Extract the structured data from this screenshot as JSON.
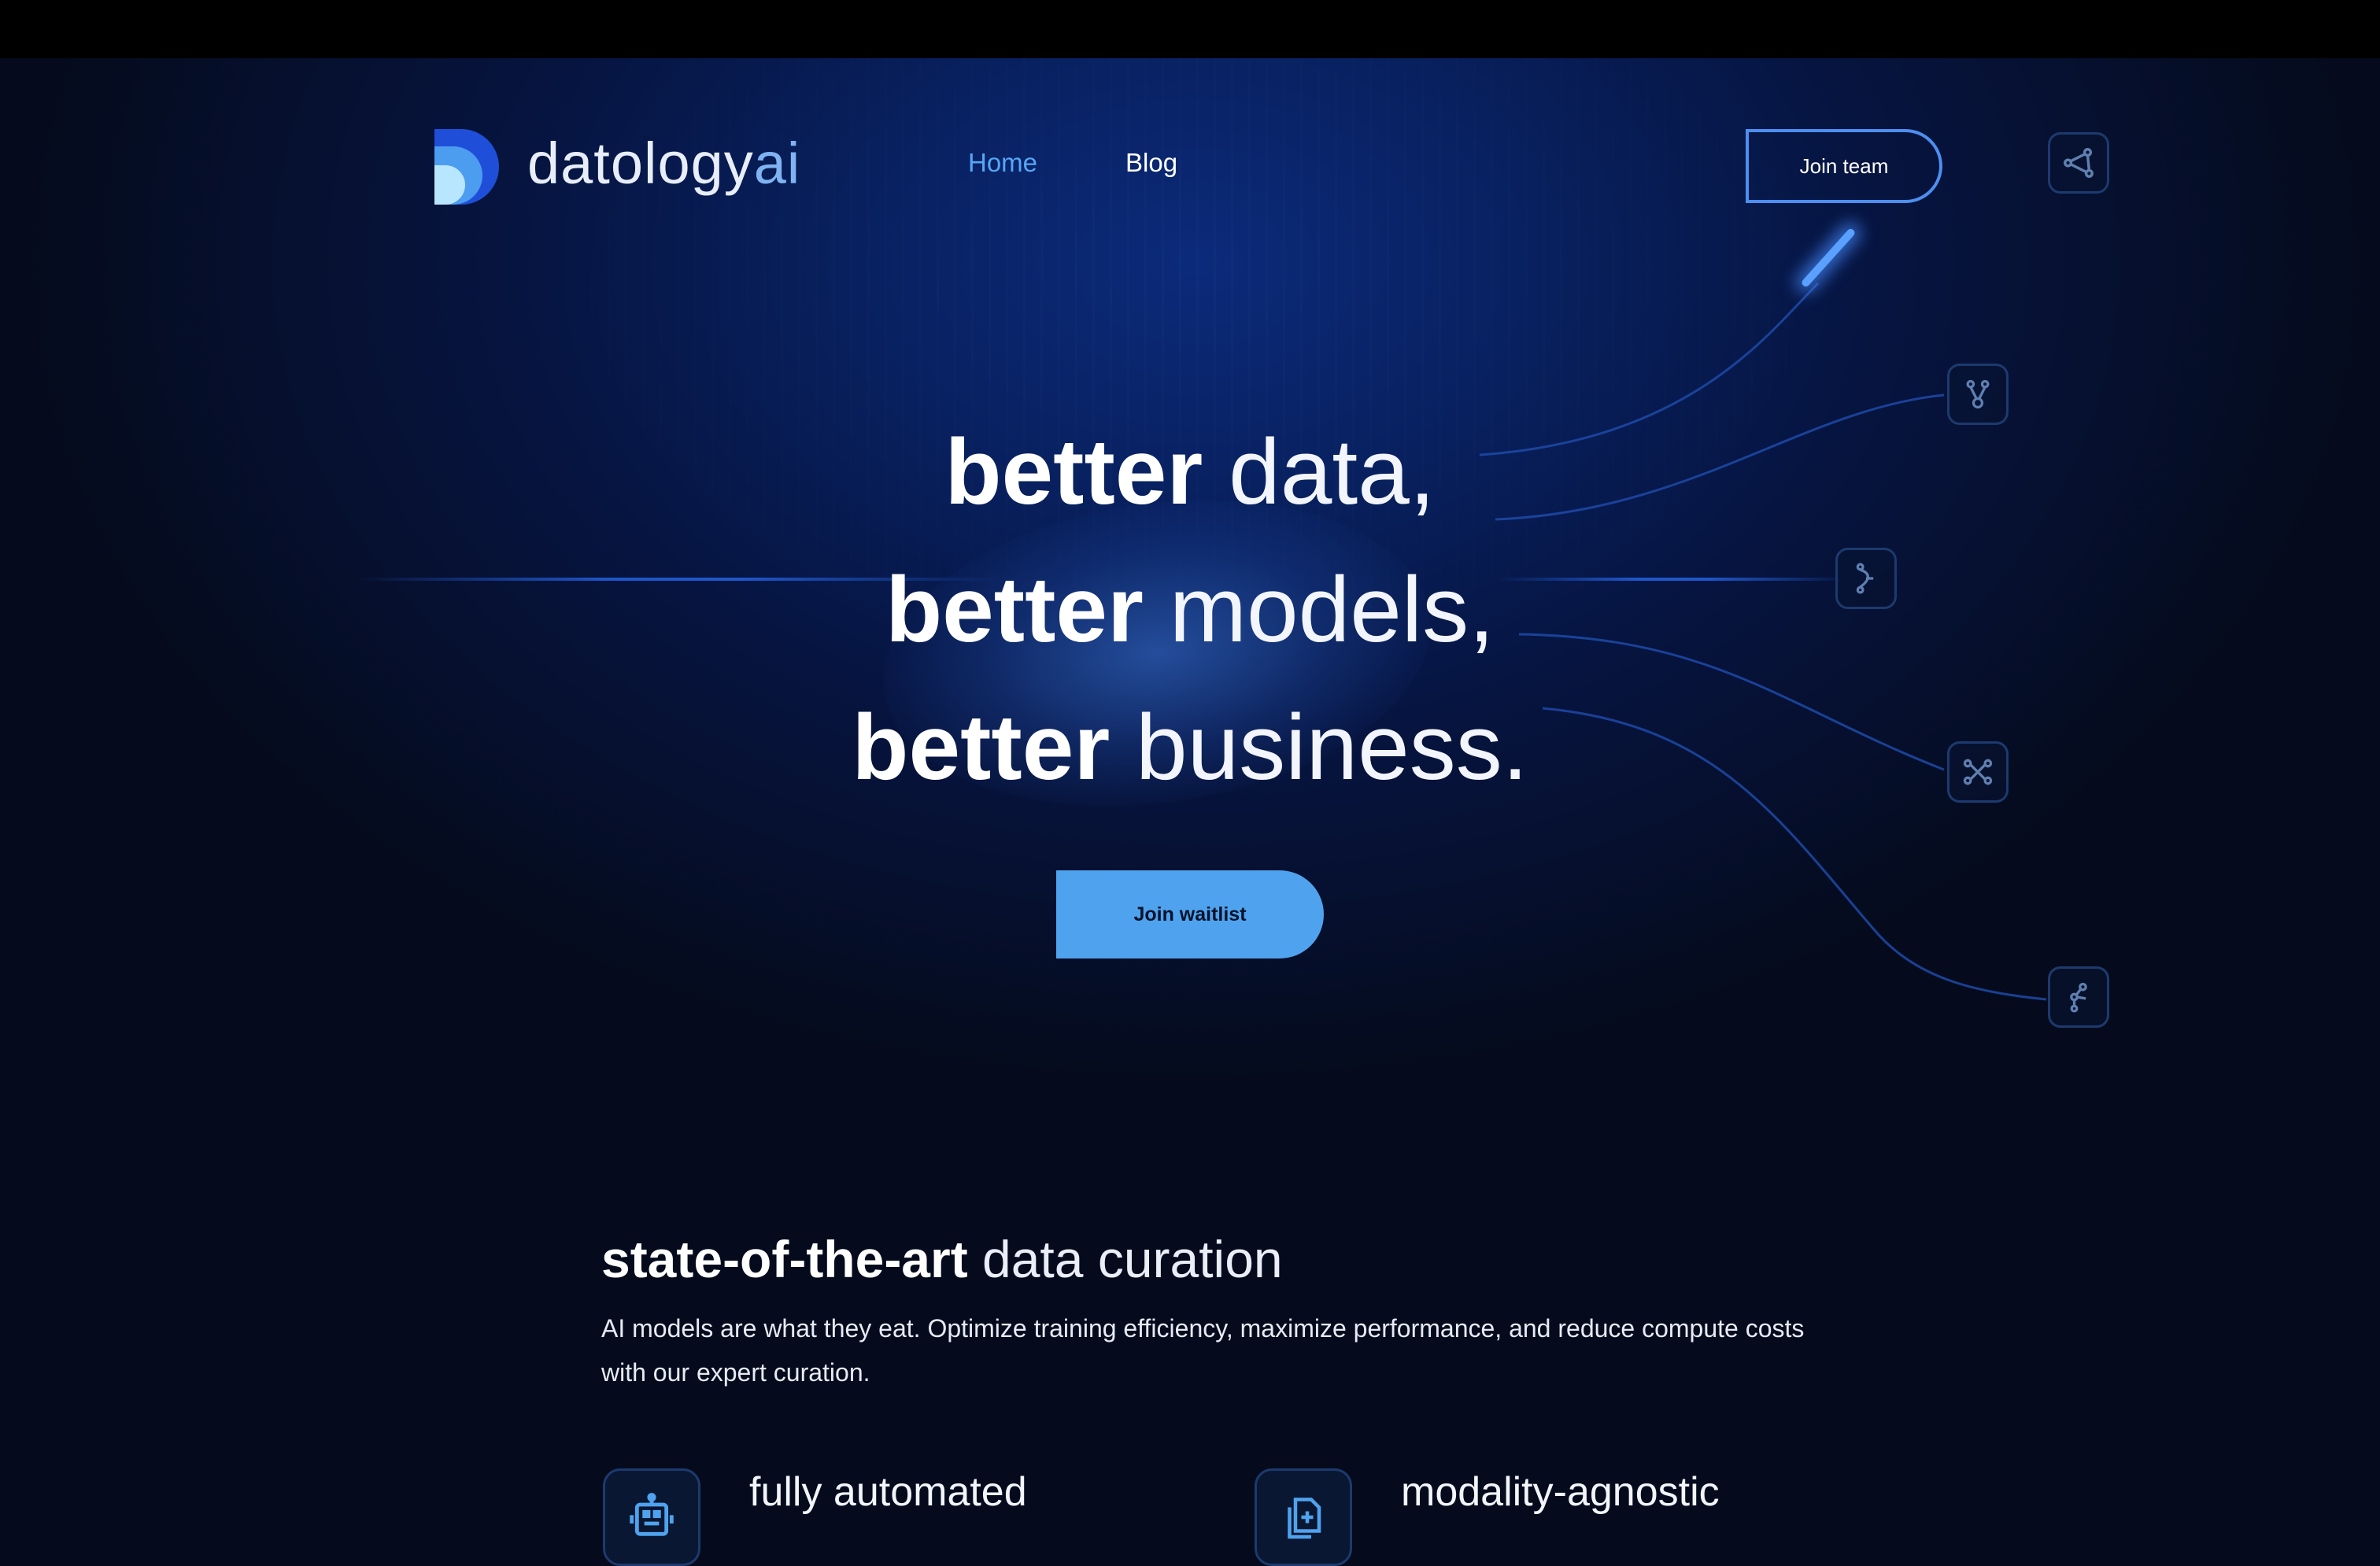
{
  "brand": {
    "name_main": "datology",
    "name_suffix": "ai"
  },
  "nav": {
    "home": "Home",
    "blog": "Blog"
  },
  "header": {
    "join_team": "Join team"
  },
  "hero": {
    "line1_bold": "better",
    "line1_light": " data,",
    "line2_bold": "better",
    "line2_light": " models,",
    "line3_bold": "better",
    "line3_light": " business.",
    "cta": "Join waitlist"
  },
  "section": {
    "title_bold": "state-of-the-art",
    "title_light": " data curation",
    "description": "AI models are what they eat. Optimize training efficiency, maximize performance, and reduce compute costs with our expert curation."
  },
  "features": [
    {
      "label": "fully automated",
      "icon": "robot-icon"
    },
    {
      "label": "modality-agnostic",
      "icon": "document-icon"
    }
  ],
  "side_icons": [
    "graph-icon",
    "branch-icon",
    "flow-icon",
    "network-icon",
    "route-icon"
  ],
  "colors": {
    "accent": "#4fa3ee",
    "nav_active": "#58a6f5",
    "background": "#050b1c"
  }
}
